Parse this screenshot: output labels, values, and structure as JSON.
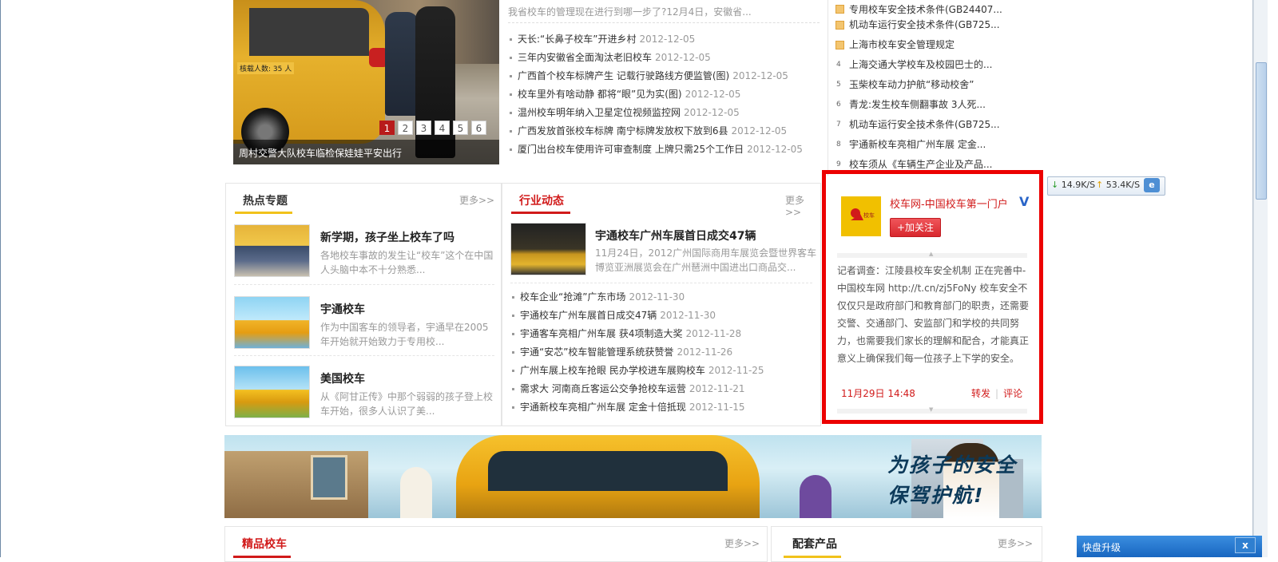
{
  "slideshow": {
    "caption": "周村交警大队校车临检保娃娃平安出行",
    "bus_label": "核载人数: 35 人",
    "pages": [
      "1",
      "2",
      "3",
      "4",
      "5",
      "6"
    ],
    "active_page": "1"
  },
  "top_news": {
    "summary": "我省校车的管理现在进行到哪一步了?12月4日，安徽省...",
    "items": [
      {
        "title": "天长:“长鼻子校车”开进乡村",
        "date": "2012-12-05"
      },
      {
        "title": "三年内安徽省全面淘汰老旧校车",
        "date": "2012-12-05"
      },
      {
        "title": "广西首个校车标牌产生 记载行驶路线方便监管(图)",
        "date": "2012-12-05"
      },
      {
        "title": "校车里外有啥动静 都将“眼”见为实(图)",
        "date": "2012-12-05"
      },
      {
        "title": "温州校车明年纳入卫星定位视频监控网",
        "date": "2012-12-05"
      },
      {
        "title": "广西发放首张校车标牌 南宁标牌发放权下放到6县",
        "date": "2012-12-05"
      },
      {
        "title": "厦门出台校车使用许可审查制度 上牌只需25个工作日",
        "date": "2012-12-05"
      }
    ]
  },
  "ranking": {
    "items": [
      {
        "num": "",
        "title": "专用校车安全技术条件(GB24407..."
      },
      {
        "num": "",
        "title": "机动车运行安全技术条件(GB725..."
      },
      {
        "num": "",
        "title": "上海市校车安全管理规定"
      },
      {
        "num": "4",
        "title": "上海交通大学校车及校园巴士的..."
      },
      {
        "num": "5",
        "title": "玉柴校车动力护航“移动校舍”"
      },
      {
        "num": "6",
        "title": "青龙:发生校车侧翻事故 3人死..."
      },
      {
        "num": "7",
        "title": "机动车运行安全技术条件(GB725..."
      },
      {
        "num": "8",
        "title": "宇通新校车亮相广州车展 定金..."
      },
      {
        "num": "9",
        "title": "校车须从《车辆生产企业及产品..."
      }
    ]
  },
  "speed_widget": {
    "down": "14.9K/S",
    "up": "53.4K/S",
    "down_arrow": "↓",
    "up_arrow": "↑",
    "icon_glyph": "e"
  },
  "hot_topics": {
    "title": "热点专题",
    "more": "更多>>",
    "items": [
      {
        "title": "新学期，孩子坐上校车了吗",
        "desc": "各地校车事故的发生让“校车”这个在中国人头脑中本不十分熟悉..."
      },
      {
        "title": "宇通校车",
        "desc": "作为中国客车的领导者，宇通早在2005年开始就开始致力于专用校..."
      },
      {
        "title": "美国校车",
        "desc": "从《阿甘正传》中那个弱弱的孩子登上校车开始，很多人认识了美..."
      }
    ]
  },
  "industry_news": {
    "title": "行业动态",
    "more": "更多>>",
    "headline": "宇通校车广州车展首日成交47辆",
    "headline_desc": "11月24日，2012广州国际商用车展览会暨世界客车博览亚洲展览会在广州琶洲中国进出口商品交...",
    "items": [
      {
        "title": "校车企业“抢滩”广东市场",
        "date": "2012-11-30"
      },
      {
        "title": "宇通校车广州车展首日成交47辆",
        "date": "2012-11-30"
      },
      {
        "title": "宇通客车亮相广州车展 获4项制造大奖",
        "date": "2012-11-28"
      },
      {
        "title": "宇通“安芯”校车智能管理系统获赞誉",
        "date": "2012-11-26"
      },
      {
        "title": "广州车展上校车抢眼 民办学校进车展购校车",
        "date": "2012-11-25"
      },
      {
        "title": "需求大 河南商丘客运公交争抢校车运营",
        "date": "2012-11-21"
      },
      {
        "title": "宇通新校车亮相广州车展 定金十倍抵现",
        "date": "2012-11-15"
      }
    ]
  },
  "weibo": {
    "account_name": "校车网-中国校车第一门户",
    "verified_mark": "V",
    "logo_text": "校车网",
    "follow_label": "+加关注",
    "post_text": "记者调查：江陵县校车安全机制 正在完善中-中国校车网 http://t.cn/zj5FoNy 校车安全不仅仅只是政府部门和教育部门的职责，还需要交警、交通部门、安监部门和学校的共同努力，也需要我们家长的理解和配合，才能真正意义上确保我们每一位孩子上下学的安全。",
    "time": "11月29日 14:48",
    "repost": "转发",
    "comment": "评论",
    "up_glyph": "▲",
    "down_glyph": "▼"
  },
  "banner": {
    "slogan_line1": "为孩子的安全",
    "slogan_line2": "保驾护航!"
  },
  "bottom": {
    "left_title": "精品校车",
    "left_more": "更多>>",
    "right_title": "配套产品",
    "right_more": "更多>>"
  },
  "notify": {
    "title": "快盘升级",
    "close": "x"
  },
  "colors": {
    "accent_red": "#d11a1a",
    "accent_yellow": "#f1c21b",
    "highlight_border": "#ec0000"
  }
}
